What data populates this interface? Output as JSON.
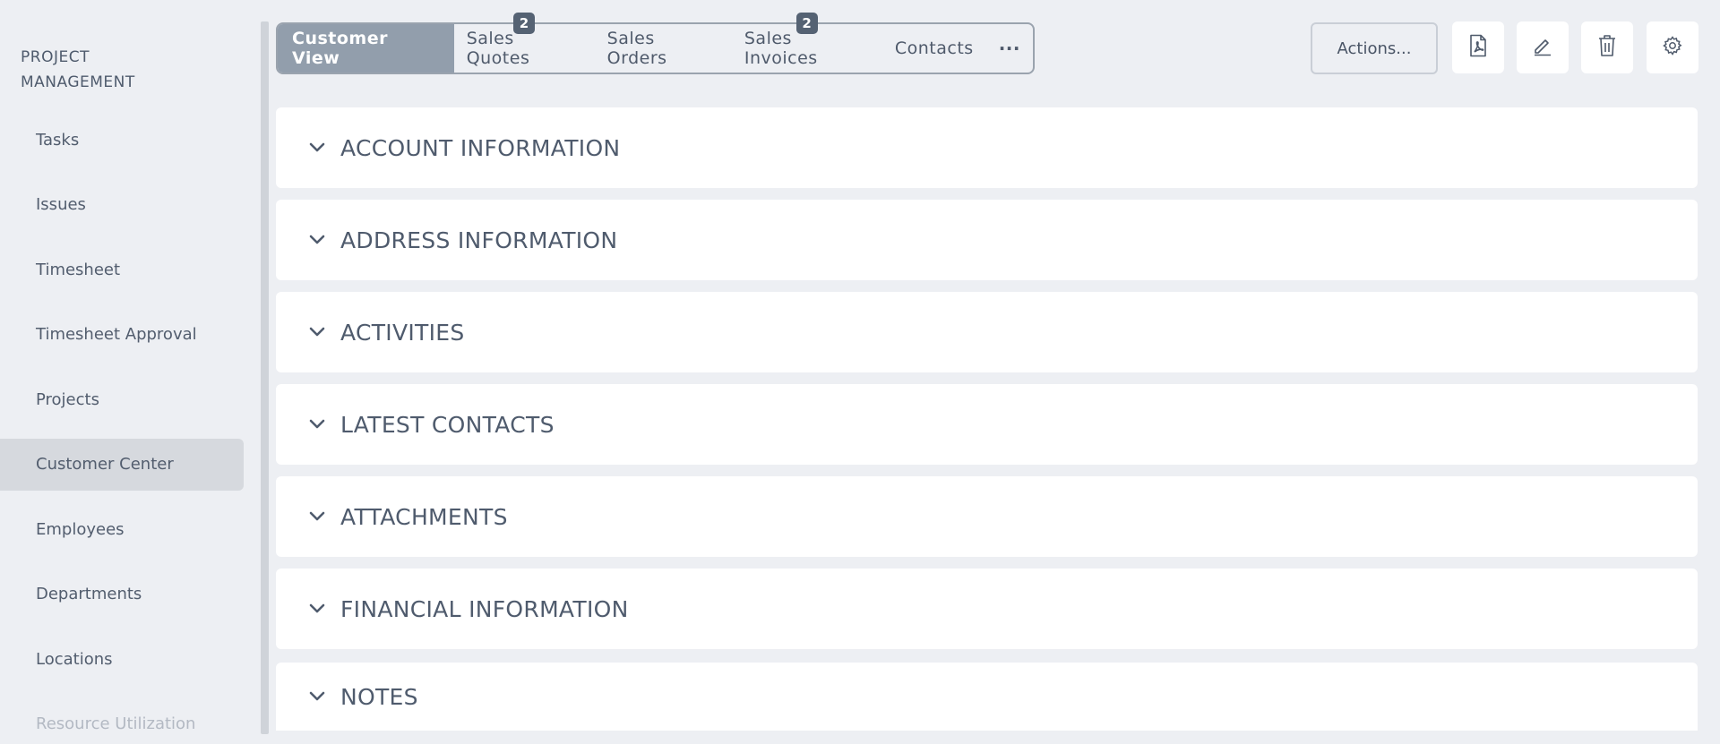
{
  "sidebar": {
    "title": "PROJECT MANAGEMENT",
    "items": [
      {
        "label": "Tasks"
      },
      {
        "label": "Issues"
      },
      {
        "label": "Timesheet"
      },
      {
        "label": "Timesheet Approval"
      },
      {
        "label": "Projects"
      },
      {
        "label": "Customer Center",
        "active": true
      },
      {
        "label": "Employees"
      },
      {
        "label": "Departments"
      },
      {
        "label": "Locations"
      },
      {
        "label": "Resource Utilization"
      }
    ]
  },
  "tabs": [
    {
      "label": "Customer View",
      "active": true,
      "badge": null
    },
    {
      "label": "Sales Quotes",
      "badge": "2"
    },
    {
      "label": "Sales Orders",
      "badge": null
    },
    {
      "label": "Sales Invoices",
      "badge": "2"
    },
    {
      "label": "Contacts",
      "badge": null
    }
  ],
  "tabs_more_label": "···",
  "toolbar": {
    "actions_label": "Actions...",
    "icons": [
      "pdf-icon",
      "edit-icon",
      "trash-icon",
      "gear-icon"
    ]
  },
  "sections": [
    {
      "title": "ACCOUNT INFORMATION"
    },
    {
      "title": "ADDRESS INFORMATION"
    },
    {
      "title": "ACTIVITIES"
    },
    {
      "title": "LATEST CONTACTS"
    },
    {
      "title": "ATTACHMENTS"
    },
    {
      "title": "FINANCIAL INFORMATION"
    },
    {
      "title": "NOTES"
    }
  ],
  "colors": {
    "background": "#edeff3",
    "active_tab": "#929eac",
    "badge": "#556273",
    "active_sidebar": "#d6d9de"
  }
}
